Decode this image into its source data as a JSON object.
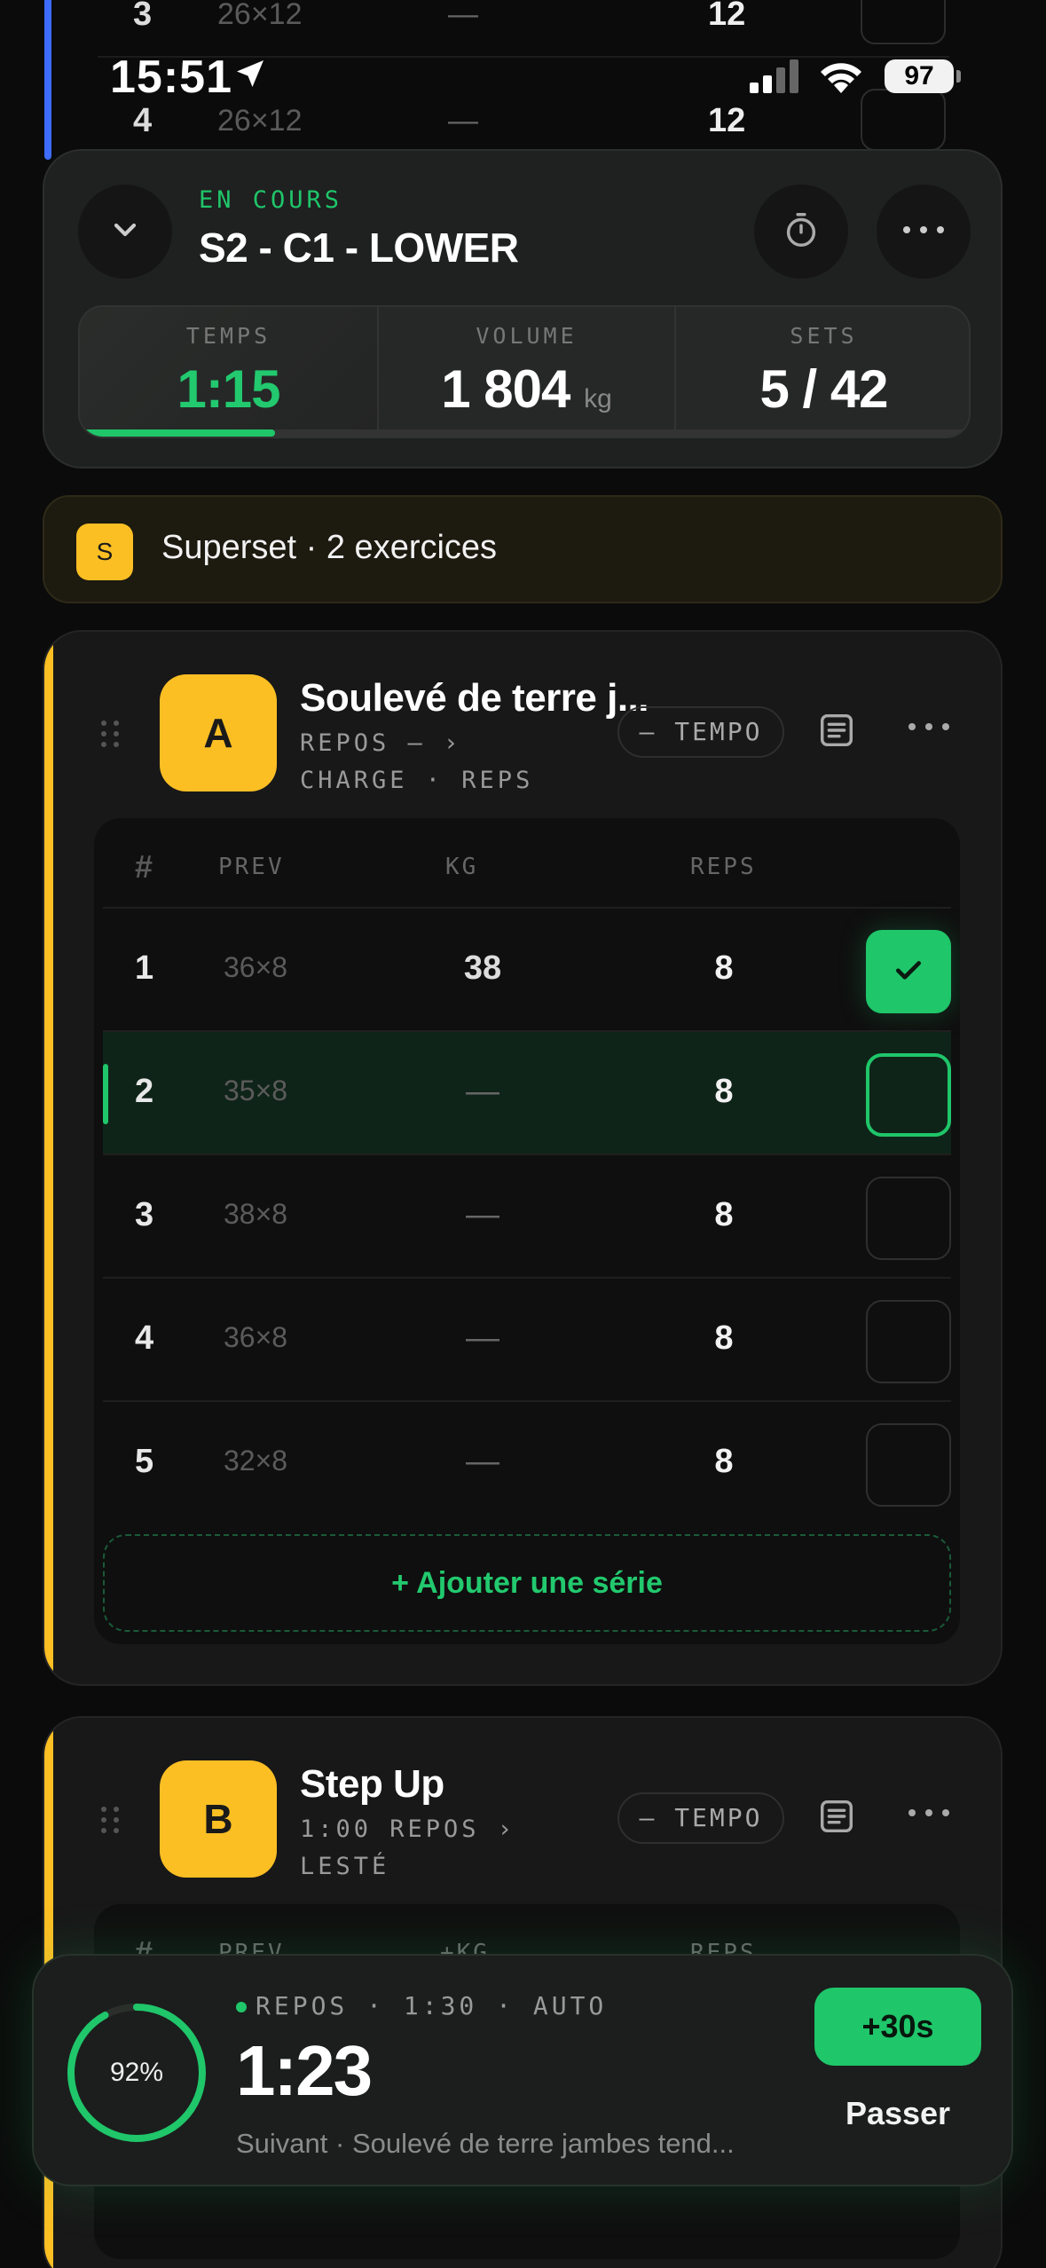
{
  "status_bar": {
    "time": "15:51",
    "battery": "97"
  },
  "bg_rows": [
    {
      "num": "3",
      "prev": "26×12",
      "kg": "—",
      "reps": "12"
    },
    {
      "num": "4",
      "prev": "26×12",
      "kg": "—",
      "reps": "12"
    }
  ],
  "workout": {
    "status": "EN COURS",
    "title": "S2 - C1 - LOWER",
    "stats": {
      "time_label": "TEMPS",
      "time_value": "1:15",
      "volume_label": "VOLUME",
      "volume_value": "1 804",
      "volume_unit": "kg",
      "sets_label": "SETS",
      "sets_value": "5 / 42"
    },
    "progress_fraction": 0.22
  },
  "superset": {
    "badge": "S",
    "text": "Superset · 2 exercices"
  },
  "exercise_a": {
    "letter": "A",
    "name": "Soulevé de terre j...",
    "sub1": "REPOS — ›",
    "sub2": "CHARGE · REPS",
    "tempo": "— TEMPO",
    "table_headers": {
      "hash": "#",
      "prev": "PREV",
      "kg": "KG",
      "reps": "REPS"
    },
    "sets": [
      {
        "num": "1",
        "prev": "36×8",
        "kg": "38",
        "reps": "8",
        "state": "done"
      },
      {
        "num": "2",
        "prev": "35×8",
        "kg": "—",
        "reps": "8",
        "state": "current"
      },
      {
        "num": "3",
        "prev": "38×8",
        "kg": "—",
        "reps": "8",
        "state": "todo"
      },
      {
        "num": "4",
        "prev": "36×8",
        "kg": "—",
        "reps": "8",
        "state": "todo"
      },
      {
        "num": "5",
        "prev": "32×8",
        "kg": "—",
        "reps": "8",
        "state": "todo"
      }
    ],
    "add_set": "+ Ajouter une série"
  },
  "exercise_b": {
    "letter": "B",
    "name": "Step Up",
    "sub1": "1:00 REPOS ›",
    "sub2": "LESTÉ",
    "tempo": "— TEMPO",
    "table_headers": {
      "hash": "#",
      "prev": "PREV",
      "kg": "+KG",
      "reps": "REPS"
    }
  },
  "rest_timer": {
    "percent": "92%",
    "percent_value": 0.92,
    "label": "REPOS · 1:30 · AUTO",
    "time": "1:23",
    "next": "Suivant · Soulevé de terre jambes tend...",
    "add_button": "+30s",
    "skip_button": "Passer"
  },
  "colors": {
    "accent": "#1fc66a",
    "superset": "#fbbf24",
    "link": "#3d6cff"
  },
  "icons": [
    "location-arrow-icon",
    "signal-icon",
    "wifi-icon",
    "chevron-down-icon",
    "stopwatch-icon",
    "more-icon",
    "drag-handle-icon",
    "notes-icon",
    "check-icon"
  ]
}
